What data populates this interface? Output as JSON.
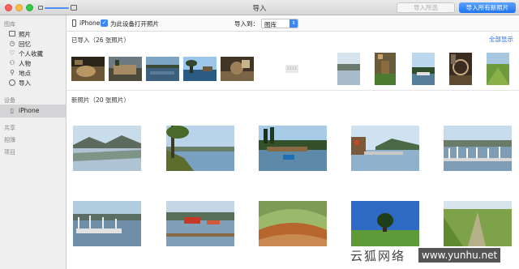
{
  "window": {
    "title": "导入"
  },
  "buttons": {
    "import_selected": "导入所选",
    "import_all": "导入所有新照片"
  },
  "sidebar": {
    "library_header": "图库",
    "library_items": [
      {
        "label": "照片",
        "icon": "photos-icon"
      },
      {
        "label": "回忆",
        "icon": "memories-icon"
      },
      {
        "label": "个人收藏",
        "icon": "heart-icon"
      },
      {
        "label": "人物",
        "icon": "person-icon"
      },
      {
        "label": "地点",
        "icon": "pin-icon"
      },
      {
        "label": "导入",
        "icon": "clock-icon"
      }
    ],
    "devices_header": "设备",
    "device_item": "iPhone",
    "shared_header": "共享",
    "albums_header": "相簿",
    "projects_header": "项目"
  },
  "toolbar": {
    "device_name": "iPhone",
    "open_photos_label": "为此设备打开照片",
    "import_to_label": "导入到：",
    "import_to_value": "图库"
  },
  "sections": {
    "imported_title": "已导入（26 张照片）",
    "show_all": "全部显示",
    "new_title": "新照片（20 张照片）"
  },
  "placeholder_text": "1111",
  "watermark": {
    "text": "云狐网络",
    "url": "www.yunhu.net"
  },
  "colors": {
    "accent": "#2a6ff0",
    "selected_row": "#d4d4d6",
    "sidebar_bg": "#f0eff0"
  }
}
